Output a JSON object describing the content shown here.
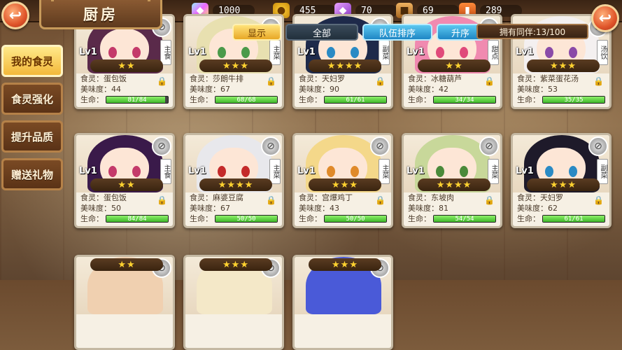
{
  "header": {
    "title": "厨房",
    "resources": [
      {
        "icon": "diamond-icon",
        "glyph": "◆",
        "value": "1000"
      },
      {
        "icon": "coin-icon",
        "glyph": "●",
        "value": "455"
      },
      {
        "icon": "gem-icon",
        "glyph": "◆",
        "value": "70"
      },
      {
        "icon": "crate-icon",
        "glyph": "■",
        "value": "69"
      },
      {
        "icon": "jar-icon",
        "glyph": "▮",
        "value": "289"
      }
    ],
    "back_glyph": "↩"
  },
  "sidebar": {
    "items": [
      {
        "label": "我的食灵",
        "active": true
      },
      {
        "label": "食灵强化",
        "active": false
      },
      {
        "label": "提升品质",
        "active": false
      },
      {
        "label": "赠送礼物",
        "active": false
      }
    ]
  },
  "filters": {
    "show": "显示",
    "all": "全部",
    "sort": "队伍排序",
    "asc": "升序",
    "owned": "拥有同伴:13/100"
  },
  "labels": {
    "level": "Lv1",
    "name_prefix": "食灵：",
    "taste_prefix": "美味度：",
    "hp_prefix": "生命："
  },
  "cards": [
    {
      "name": "蛋包饭",
      "taste": "44",
      "hp": "81/84",
      "hp_ratio": 0.96,
      "stars": "★★",
      "tag": "主食",
      "hair": "#5a2a4a",
      "eye": "#c43a6a"
    },
    {
      "name": "莎朗牛排",
      "taste": "67",
      "hp": "68/68",
      "hp_ratio": 1.0,
      "stars": "★★★",
      "tag": "主菜",
      "hair": "#e8e0b0",
      "eye": "#4a9a4a"
    },
    {
      "name": "天妇罗",
      "taste": "90",
      "hp": "61/61",
      "hp_ratio": 1.0,
      "stars": "★★★★",
      "tag": "副菜",
      "hair": "#1e2a4a",
      "eye": "#2a8ac4"
    },
    {
      "name": "冰糖葫芦",
      "taste": "42",
      "hp": "34/34",
      "hp_ratio": 1.0,
      "stars": "★★",
      "tag": "甜点",
      "hair": "#f08ab0",
      "eye": "#e04a7a"
    },
    {
      "name": "紫菜蛋花汤",
      "taste": "53",
      "hp": "35/35",
      "hp_ratio": 1.0,
      "stars": "★★★",
      "tag": "汤饮",
      "hair": "#f4f0f0",
      "eye": "#8a4aa8"
    },
    {
      "name": "蛋包饭",
      "taste": "50",
      "hp": "84/84",
      "hp_ratio": 1.0,
      "stars": "★★",
      "tag": "主食",
      "hair": "#3a1a4a",
      "eye": "#c43a6a"
    },
    {
      "name": "麻婆豆腐",
      "taste": "67",
      "hp": "50/50",
      "hp_ratio": 1.0,
      "stars": "★★★★",
      "tag": "主菜",
      "hair": "#e8e8ec",
      "eye": "#c42a2a"
    },
    {
      "name": "宫爆鸡丁",
      "taste": "43",
      "hp": "50/50",
      "hp_ratio": 1.0,
      "stars": "★★★",
      "tag": "主菜",
      "hair": "#f4d88a",
      "eye": "#e08a2a"
    },
    {
      "name": "东坡肉",
      "taste": "81",
      "hp": "54/54",
      "hp_ratio": 1.0,
      "stars": "★★★★",
      "tag": "主菜",
      "hair": "#c8d89a",
      "eye": "#4a8a3a"
    },
    {
      "name": "天妇罗",
      "taste": "62",
      "hp": "61/61",
      "hp_ratio": 1.0,
      "stars": "★★★",
      "tag": "副菜",
      "hair": "#1e1a2a",
      "eye": "#2a8ac4"
    }
  ],
  "partial_cards": [
    {
      "stars": "★★",
      "hair": "#f0d0b0"
    },
    {
      "stars": "★★★",
      "hair": "#f4e8c8"
    },
    {
      "stars": "★★★",
      "hair": "#4a5ad8"
    }
  ]
}
